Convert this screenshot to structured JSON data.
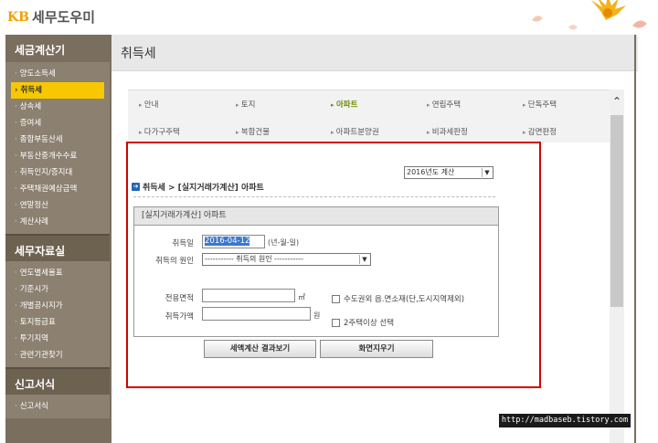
{
  "brand": {
    "mark": "KB",
    "name": "세무도우미"
  },
  "sidebar": {
    "sections": [
      {
        "title": "세금계산기",
        "items": [
          "양도소득세",
          "취득세",
          "상속세",
          "증여세",
          "종합부동산세",
          "부동산중개수수료",
          "취득인지/증지대",
          "주택채권예상금액",
          "연말정산",
          "계산사례"
        ]
      },
      {
        "title": "세무자료실",
        "items": [
          "연도별세율표",
          "기준시가",
          "개별공시지가",
          "토지등급표",
          "투기지역",
          "관련기관찾기"
        ]
      },
      {
        "title": "신고서식",
        "items": [
          "신고서식"
        ]
      }
    ],
    "selected": "취득세"
  },
  "page": {
    "title": "취득세"
  },
  "tabs": {
    "row1": [
      "안내",
      "토지",
      "아파트",
      "연립주택",
      "단독주택"
    ],
    "row2": [
      "다가구주택",
      "복합건물",
      "아파트분양권",
      "비과세판정",
      "감면판정"
    ],
    "active": "아파트"
  },
  "form": {
    "year_select": "2016년도 계산",
    "breadcrumb": "취득세 > [실지거래가계산] 아파트",
    "panel_title": "[실지거래가계산] 아파트",
    "acq_date_label": "취득일",
    "acq_date_value": "2016-04-12",
    "acq_date_hint": "(년-월-일)",
    "cause_label": "취득의 원인",
    "cause_value": "----------- 취득의 원인 -----------",
    "area_label": "전용면적",
    "area_unit": "㎡",
    "price_label": "취득가액",
    "price_unit": "원",
    "chk_capital": "수도권외 읍.면소재(단,도시지역제외)",
    "chk_two_homes": "2주택이상 선택",
    "btn_calc": "세액계산 결과보기",
    "btn_clear": "화면지우기"
  },
  "watermark": "http://madbaseb.tistory.com",
  "colors": {
    "sidebar": "#7a6e5e",
    "highlight": "#f7c800",
    "active_tab": "#6c8a00",
    "frame": "#d40000"
  }
}
